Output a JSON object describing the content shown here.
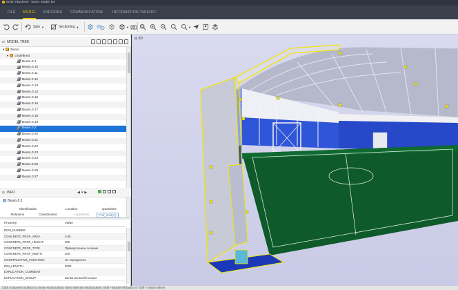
{
  "app": {
    "title": "Dmitri Abysheve - home. Model. ker",
    "accent": "#f4c400",
    "selection_color": "#1e73d6"
  },
  "menu": {
    "tabs": [
      "FILE",
      "MODEL",
      "CHECKING",
      "COMMUNICATION",
      "INFORMATION TAKEOFF"
    ],
    "active": "MODEL"
  },
  "toolbar": {
    "spin_label": "Spin",
    "sectioning_label": "Sectioning"
  },
  "model_tree": {
    "title": "MODEL TREE",
    "root": "Beam",
    "group": "Undefined",
    "items": [
      "Beam.0.1",
      "Beam.0.10",
      "Beam.0.11",
      "Beam.0.12",
      "Beam.0.13",
      "Beam.0.14",
      "Beam.0.15",
      "Beam.0.16",
      "Beam.0.17",
      "Beam.0.18",
      "Beam.0.19",
      "Beam.0.2",
      "Beam.0.20",
      "Beam.0.21",
      "Beam.0.22",
      "Beam.0.23",
      "Beam.0.24",
      "Beam.0.25",
      "Beam.0.26",
      "Beam.0.27"
    ],
    "selected": "Beam.0.2"
  },
  "info": {
    "title": "INFO",
    "object_name": "Beam.0.2",
    "tabs_row1": [
      "Identification",
      "Location",
      "Quantities"
    ],
    "tabs_row2": [
      "Relations",
      "Classification",
      "Hyperlinks",
      "Prof_Cad(A)"
    ],
    "columns": [
      "Property",
      "Value"
    ],
    "properties": [
      {
        "key": "BOM_NUMBER",
        "value": ""
      },
      {
        "key": "CONCRETE_PROF_AREA",
        "value": "0.06"
      },
      {
        "key": "CONCRETE_PROF_HEIGHT",
        "value": "300"
      },
      {
        "key": "CONCRETE_PROF_TYPE",
        "value": "Прямоугольное сечение"
      },
      {
        "key": "CONCRETE_PROF_WIDTH",
        "value": "200"
      },
      {
        "key": "CONSTRUCTIVE_FUNCTION",
        "value": "Не определено"
      },
      {
        "key": "DIM_LENGTH",
        "value": "5000"
      },
      {
        "key": "EXPLICATION_COMMENT",
        "value": ""
      },
      {
        "key": "EXPLICATION_GROUP",
        "value": "Балки железобетонные"
      }
    ]
  },
  "viewport": {
    "label": "3D"
  },
  "status": {
    "text": "Click component surface to create section plane. Move selected section plane: Shift + Mouse left button or Shift + Mouse wheel"
  }
}
